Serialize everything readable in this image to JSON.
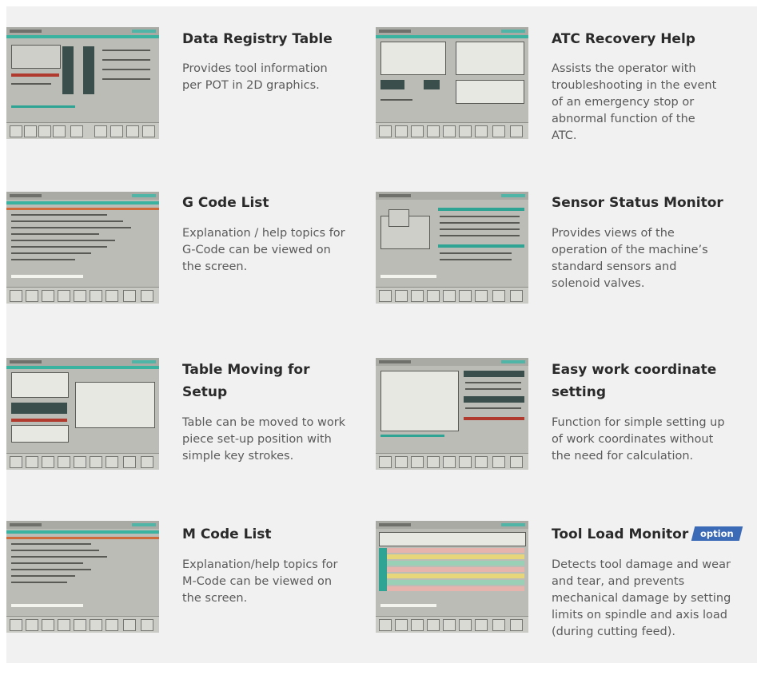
{
  "features": [
    {
      "title": "Data Registry Table",
      "description": "Provides tool information per POT in 2D graphics."
    },
    {
      "title": "ATC Recovery Help",
      "description": "Assists the operator with troubleshooting in the event of an emergency stop or abnormal function of the ATC."
    },
    {
      "title": "G Code List",
      "description": "Explanation / help topics for G-Code can be viewed on the screen."
    },
    {
      "title": "Sensor Status Monitor",
      "description": "Provides views of the operation of the machine’s standard sensors and solenoid valves."
    },
    {
      "title": "Table Moving for Setup",
      "description": "Table can be moved to work piece set-up position with simple key strokes."
    },
    {
      "title": "Easy work coordinate setting",
      "description": "Function for simple setting up of work coordinates without the need for calculation."
    },
    {
      "title": "M Code List",
      "description": "Explanation/help topics for M-Code can be viewed on the screen."
    },
    {
      "title": "Tool Load Monitor",
      "badge": "option",
      "description": "Detects tool damage and wear and tear, and prevents mechanical damage by setting limits on spindle and axis load (during cutting feed)."
    }
  ],
  "colors": {
    "panel_background": "#f1f1f1",
    "title_text": "#2a2a2a",
    "body_text": "#5a5a5a",
    "badge_background": "#3b6ab7",
    "screen_teal": "#3ab4a1"
  }
}
